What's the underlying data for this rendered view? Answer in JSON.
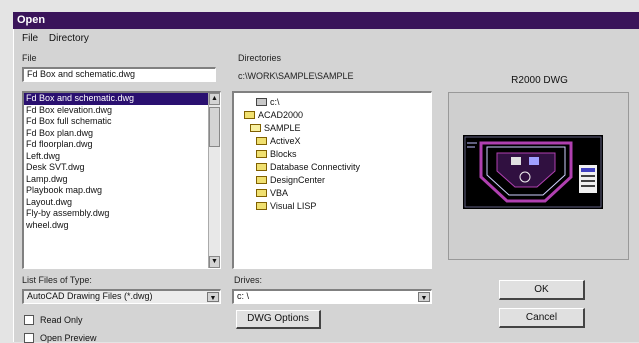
{
  "window": {
    "title": "Open"
  },
  "menu": {
    "items": [
      "File",
      "Directory"
    ]
  },
  "file_name": {
    "label": "File",
    "value": "Fd Box and schematic.dwg"
  },
  "files": {
    "items": [
      "Fd Box and schematic.dwg",
      "Fd Box elevation.dwg",
      "Fd Box full schematic",
      "Fd Box plan.dwg",
      "Fd floorplan.dwg",
      "Left.dwg",
      "Desk SVT.dwg",
      "Lamp.dwg",
      "Playbook map.dwg",
      "Layout.dwg",
      "Fly-by assembly.dwg",
      "wheel.dwg"
    ],
    "selected_index": 0
  },
  "directories": {
    "label": "Directories",
    "path": "c:\\WORK\\SAMPLE\\SAMPLE",
    "items": [
      {
        "name": "c:\\",
        "type": "drive"
      },
      {
        "name": "ACAD2000",
        "type": "folder"
      },
      {
        "name": "SAMPLE",
        "type": "folder-open"
      },
      {
        "name": "ActiveX",
        "type": "folder"
      },
      {
        "name": "Blocks",
        "type": "folder"
      },
      {
        "name": "Database Connectivity",
        "type": "folder"
      },
      {
        "name": "DesignCenter",
        "type": "folder"
      },
      {
        "name": "VBA",
        "type": "folder"
      },
      {
        "name": "Visual LISP",
        "type": "folder"
      }
    ]
  },
  "file_type": {
    "label": "List Files of Type:",
    "value": "AutoCAD Drawing Files (*.dwg)"
  },
  "drives": {
    "label": "Drives:",
    "value": "c: \\"
  },
  "dwg_options_label": "DWG Options",
  "read_only_label": "Read Only",
  "open_preview_label": "Open Preview",
  "preview": {
    "label": "R2000 DWG"
  },
  "buttons": {
    "ok": "OK",
    "cancel": "Cancel"
  },
  "colors": {
    "title_bar": "#3a145a",
    "selection": "#2a1070",
    "preview_bg": "#000000",
    "drawing_accent": "#b040b0"
  }
}
